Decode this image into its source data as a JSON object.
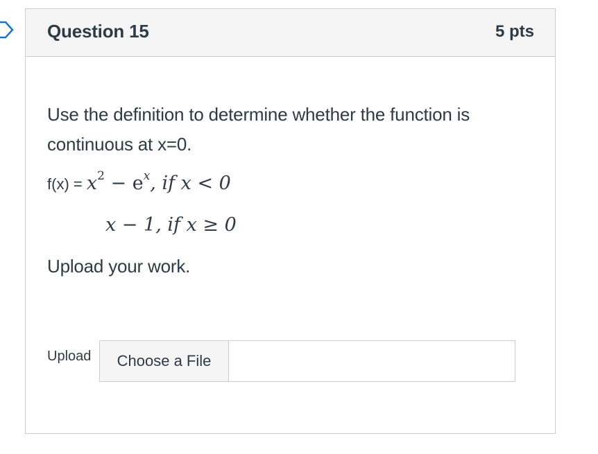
{
  "question": {
    "title": "Question 15",
    "points": "5 pts",
    "prompt": "Use the definition to determine whether the function is continuous at x=0.",
    "function_label": "f(x) = ",
    "piece1": {
      "expr_base": "x",
      "expr_exp": "2",
      "minus": " − e",
      "exp_x": "x",
      "condition": ", if x < 0"
    },
    "piece2": {
      "expr": "x − 1, if x ≥ 0"
    },
    "upload_prompt": "Upload your work."
  },
  "upload": {
    "label": "Upload",
    "button_label": "Choose a File"
  },
  "colors": {
    "header_bg": "#f5f5f5",
    "border": "#c7cdd1",
    "text": "#2d3b45",
    "flag_stroke": "#1a73c8"
  }
}
